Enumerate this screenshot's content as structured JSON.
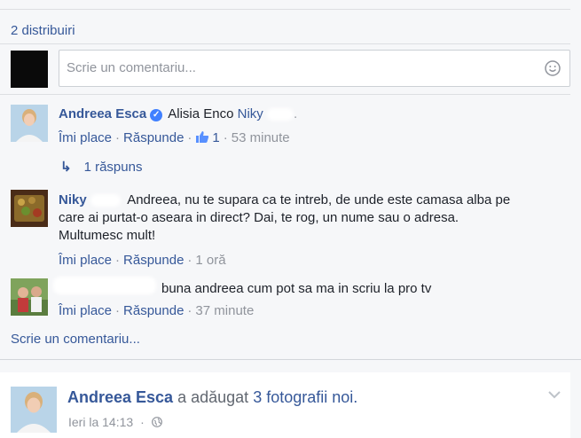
{
  "shares_label": "2 distribuiri",
  "composer": {
    "placeholder": "Scrie un comentariu..."
  },
  "comments": [
    {
      "author": "Andreea Esca",
      "verified": true,
      "mention1": "Alisia Enco",
      "mention2": "Niky",
      "like_label": "Îmi place",
      "reply_label": "Răspunde",
      "like_count": "1",
      "time": "53 minute",
      "replies_label": "1 răspuns"
    },
    {
      "author": "Niky",
      "text_line1": "Andreea, nu te supara ca te intreb, de unde este camasa alba pe",
      "text_line2": "care ai purtat-o aseara in direct? Dai, te rog, un nume sau o adresa.",
      "text_line3": "Multumesc mult!",
      "like_label": "Îmi place",
      "reply_label": "Răspunde",
      "time": "1 oră"
    },
    {
      "text": "buna andreea cum pot sa ma in scriu la pro tv",
      "like_label": "Îmi place",
      "reply_label": "Răspunde",
      "time": "37 minute"
    }
  ],
  "write_comment_link": "Scrie un comentariu...",
  "next_post": {
    "author": "Andreea Esca",
    "action_text": "a adăugat",
    "object_link": "3 fotografii noi.",
    "timestamp": "Ieri la 14:13"
  },
  "colors": {
    "link": "#365899",
    "meta": "#90949c",
    "verified": "#4080ff"
  }
}
